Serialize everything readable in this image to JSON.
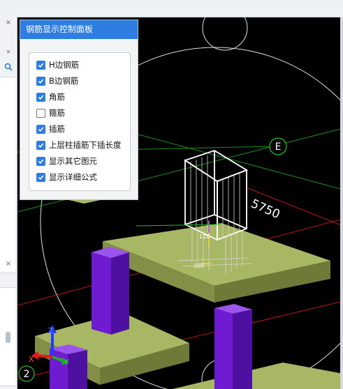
{
  "panel": {
    "title": "钢筋显示控制面板",
    "options": [
      {
        "label": "H边钢筋",
        "checked": true
      },
      {
        "label": "B边钢筋",
        "checked": true
      },
      {
        "label": "角筋",
        "checked": true
      },
      {
        "label": "箍筋",
        "checked": false
      },
      {
        "label": "插筋",
        "checked": true
      },
      {
        "label": "上层柱插筋下插长度",
        "checked": true
      },
      {
        "label": "显示其它图元",
        "checked": true
      },
      {
        "label": "显示详细公式",
        "checked": true
      }
    ]
  },
  "left_strip": {
    "close_glyph": "×",
    "expand_glyph": "»",
    "search_icon": "search-icon"
  },
  "viewport": {
    "axis_label_e": "E",
    "axis_label_2": "2",
    "dimension_5750": "5750",
    "dimension_110": "110",
    "dimension_300": "300",
    "axis_x": "X",
    "axis_y": "Y",
    "axis_z": "Z",
    "colors": {
      "background": "#000000",
      "footing": "#a7b764",
      "column": "#7a1fd8",
      "grid_green": "#1f8f1f",
      "grid_red": "#b81818",
      "rebar": "#ffffff",
      "ring": "#e6e6e6"
    }
  }
}
